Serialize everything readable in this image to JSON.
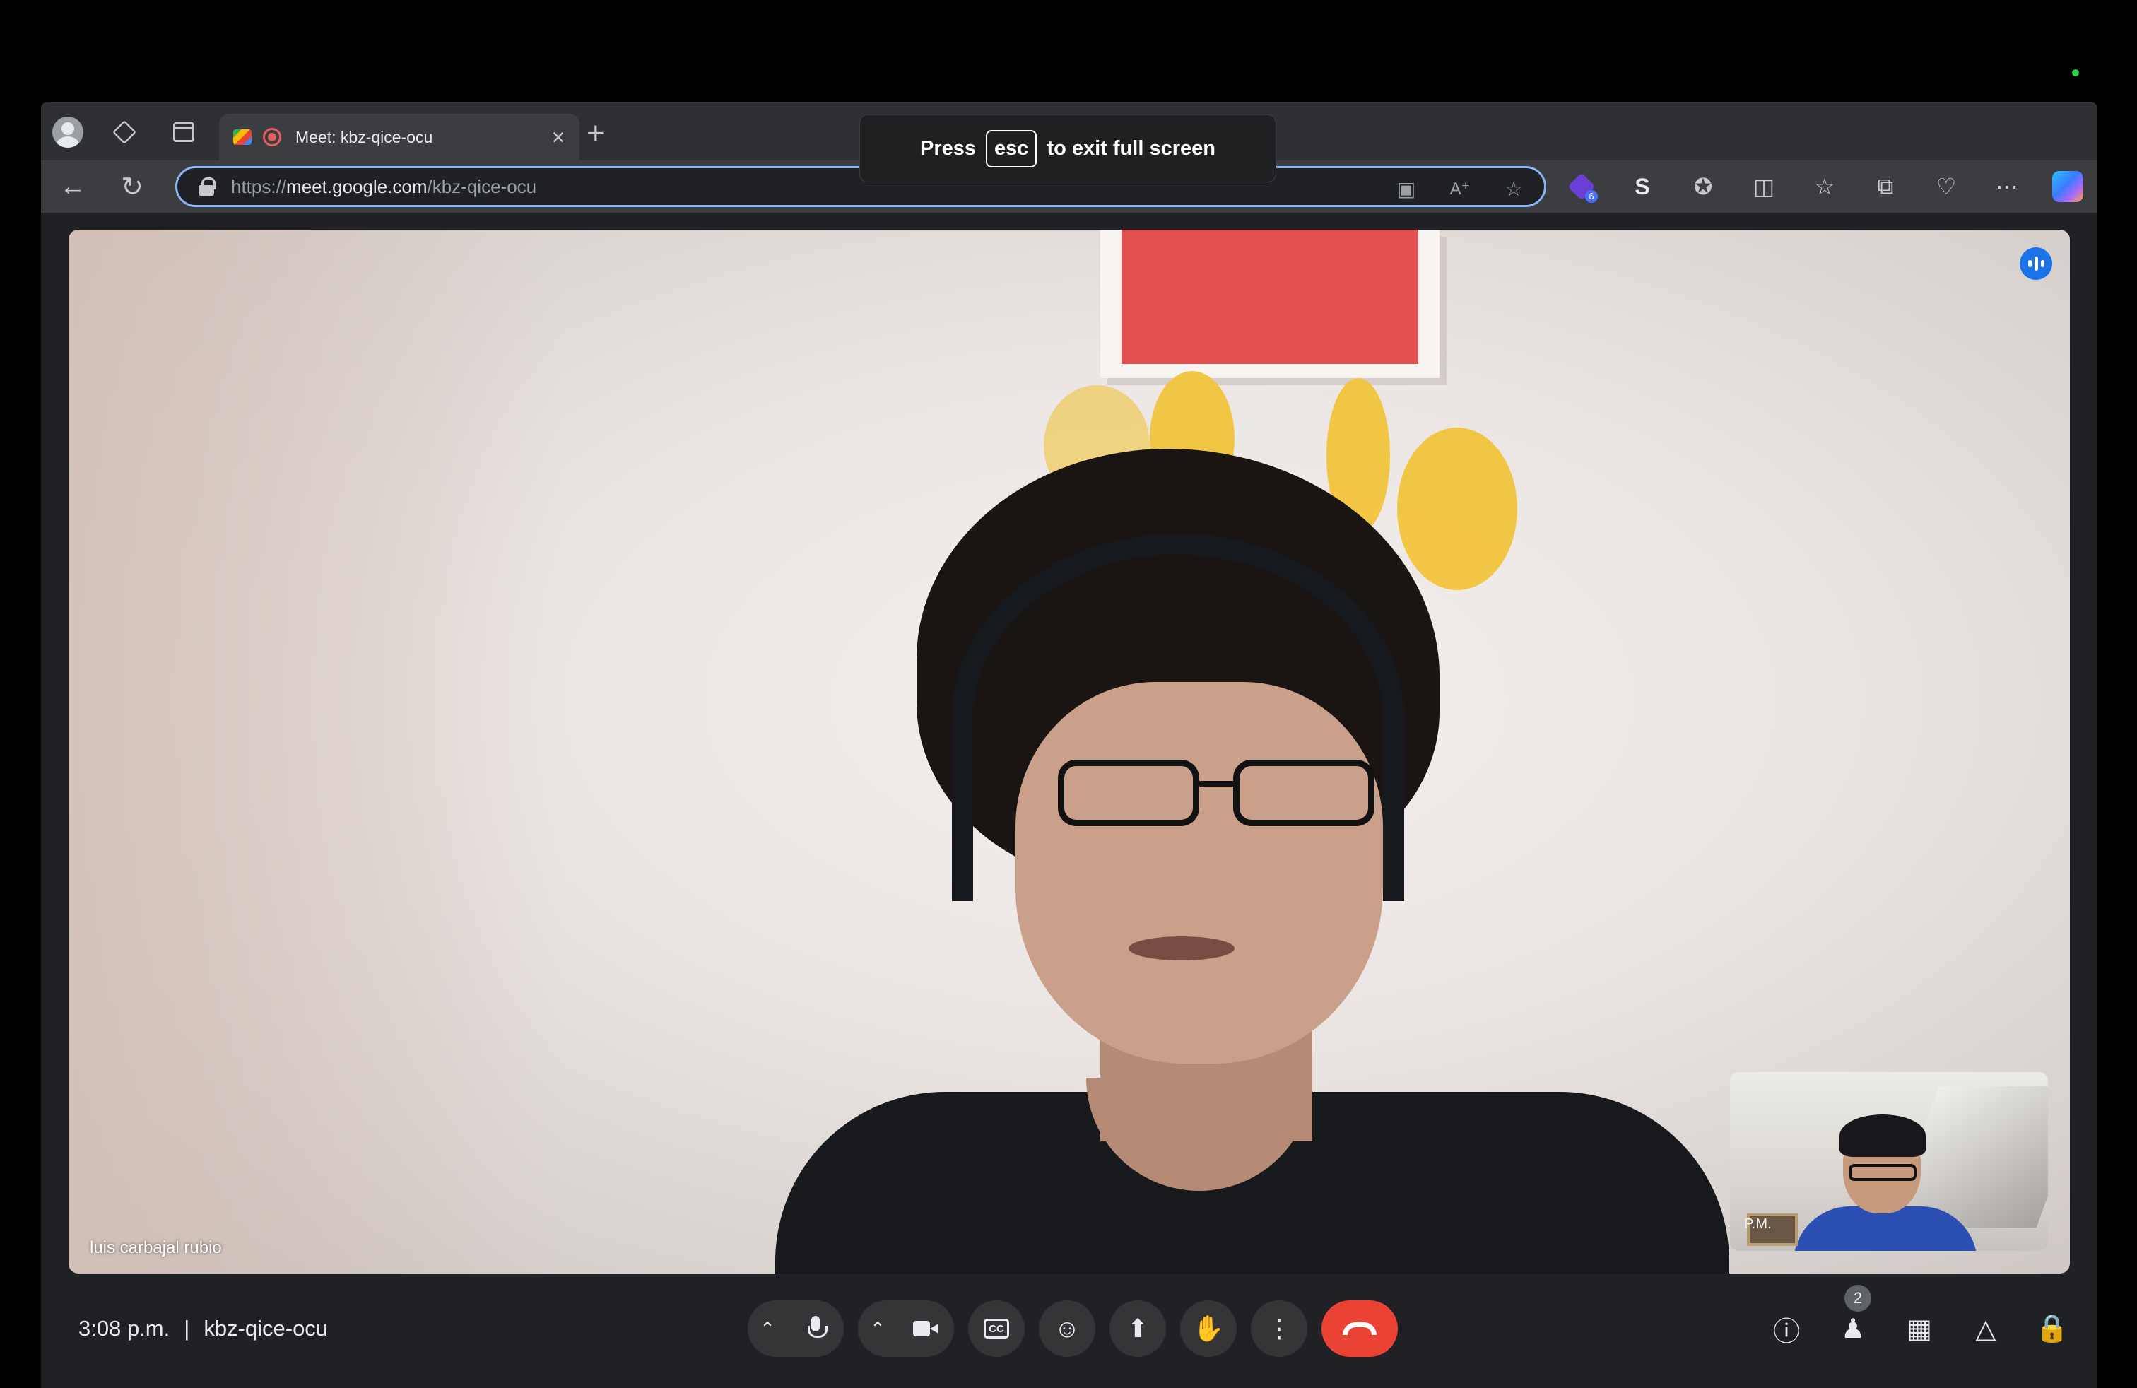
{
  "browser": {
    "tab": {
      "title": "Meet: kbz-qice-ocu",
      "close_label": "×"
    },
    "new_tab_label": "+",
    "address_bar": {
      "url_prefix": "https://",
      "url_host": "meet.google.com",
      "url_path": "/kbz-qice-ocu"
    },
    "extension_badge": "6"
  },
  "fullscreen_toast": {
    "before": "Press",
    "key": "esc",
    "after": "to exit full screen"
  },
  "meeting": {
    "main_participant": "luis carbajal rubio",
    "self_view_label": "P.M.",
    "time": "3:08 p.m.",
    "separator": "|",
    "code": "kbz-qice-ocu",
    "people_count": "2"
  },
  "colors": {
    "accent": "#8ab4f8",
    "hangup": "#ea4335",
    "speaking": "#1a73e8",
    "control_bg": "#333537"
  },
  "icons": {
    "back": "arrow-left-icon",
    "reload": "reload-icon",
    "mic": "microphone-icon",
    "camera": "camera-icon",
    "captions": "captions-icon",
    "reactions": "emoji-icon",
    "present": "present-icon",
    "hand": "raise-hand-icon",
    "more": "more-vert-icon",
    "hangup": "call-end-icon",
    "info": "info-icon",
    "people": "people-icon",
    "chat": "chat-icon",
    "activities": "activities-icon",
    "host": "host-controls-icon"
  }
}
